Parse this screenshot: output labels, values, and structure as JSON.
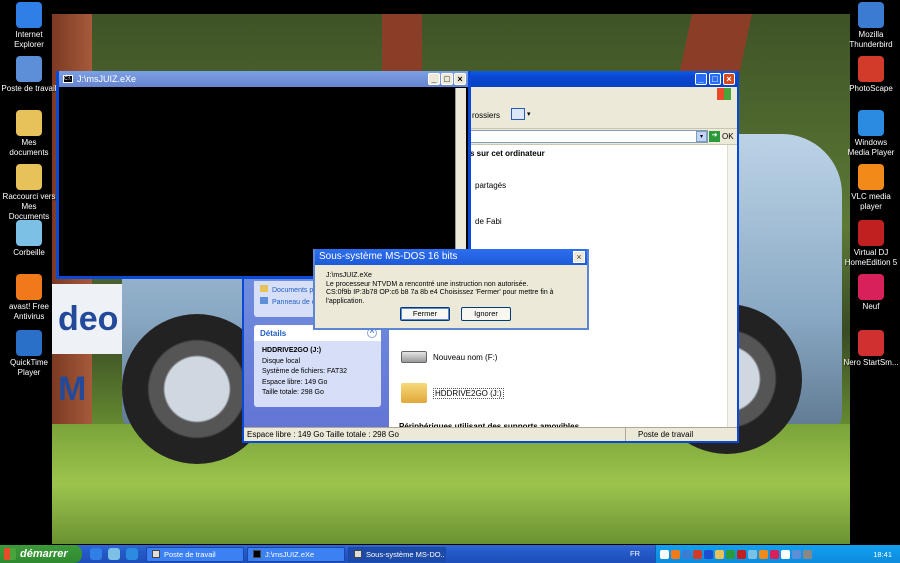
{
  "desktop": {
    "left_icons": [
      {
        "label": "Internet Explorer",
        "icon": "ie-icon",
        "color": "#2f7fe6"
      },
      {
        "label": "Poste de travail",
        "icon": "computer-icon",
        "color": "#5b8fd8"
      },
      {
        "label": "Mes documents",
        "icon": "folder-docs-icon",
        "color": "#e7c25a"
      },
      {
        "label": "Raccourci vers Mes Documents",
        "icon": "folder-shortcut-icon",
        "color": "#e7c25a"
      },
      {
        "label": "Corbeille",
        "icon": "recycle-bin-icon",
        "color": "#7dc0e6"
      },
      {
        "label": "avast! Free Antivirus",
        "icon": "avast-icon",
        "color": "#f07a1a"
      },
      {
        "label": "QuickTime Player",
        "icon": "quicktime-icon",
        "color": "#2a70c9"
      }
    ],
    "right_icons": [
      {
        "label": "Mozilla Thunderbird",
        "icon": "thunderbird-icon",
        "color": "#3b7bd1"
      },
      {
        "label": "PhotoScape",
        "icon": "photoscape-icon",
        "color": "#d23a2a"
      },
      {
        "label": "Windows Media Player",
        "icon": "media-player-icon",
        "color": "#2a8be0"
      },
      {
        "label": "VLC media player",
        "icon": "vlc-icon",
        "color": "#f28a1a"
      },
      {
        "label": "Virtual DJ HomeEdition 5",
        "icon": "virtualdj-icon",
        "color": "#c02020"
      },
      {
        "label": "Neuf",
        "icon": "neuf-icon",
        "color": "#d8205a"
      },
      {
        "label": "Nero StartSm...",
        "icon": "nero-icon",
        "color": "#d03030"
      }
    ],
    "wallpaper_text": "deo M"
  },
  "explorer": {
    "toolbar_text": "rossiers",
    "address_go": "OK",
    "sections": [
      "s sur cet ordinateur",
      "partagés",
      "de Fabi"
    ],
    "left_links": [
      "Documents pa",
      "Panneau de c"
    ],
    "details": {
      "header": "Détails",
      "name": "HDDRIVE2GO (J:)",
      "type": "Disque local",
      "fs": "Système de fichiers: FAT32",
      "free": "Espace libre: 149 Go",
      "total": "Taille totale: 298 Go"
    },
    "drives": [
      {
        "label": "Nouveau nom (F:)",
        "icon": "drive-icon"
      },
      {
        "label": "HDDRIVE2GO (J:)",
        "icon": "folder-icon"
      }
    ],
    "section_bottom": "Périphériques utilisant des supports amovibles",
    "status_left": "Espace libre : 149 Go Taille totale : 298 Go",
    "status_right": "Poste de travail"
  },
  "dos_window": {
    "title": "J:\\msJUIZ.eXe",
    "icon_text": "C:\\"
  },
  "dialog": {
    "title": "Sous-système MS-DOS 16 bits",
    "line1": "J:\\msJUIZ.eXe",
    "line2": "Le processeur NTVDM a rencontré une instruction non autorisée.",
    "line3": "CS:0f9b IP:3b78 OP:c6 b8 7a 8b e4 Choisissez 'Fermer' pour mettre fin à l'application.",
    "btn_close": "Fermer",
    "btn_ignore": "Ignorer"
  },
  "taskbar": {
    "start_label": "démarrer",
    "buttons": [
      {
        "label": "Poste de travail",
        "active": false
      },
      {
        "label": "J:\\msJUIZ.eXe",
        "active": false
      },
      {
        "label": "Sous-système MS-DO...",
        "active": true
      }
    ],
    "lang": "FR",
    "clock": "18:41"
  }
}
